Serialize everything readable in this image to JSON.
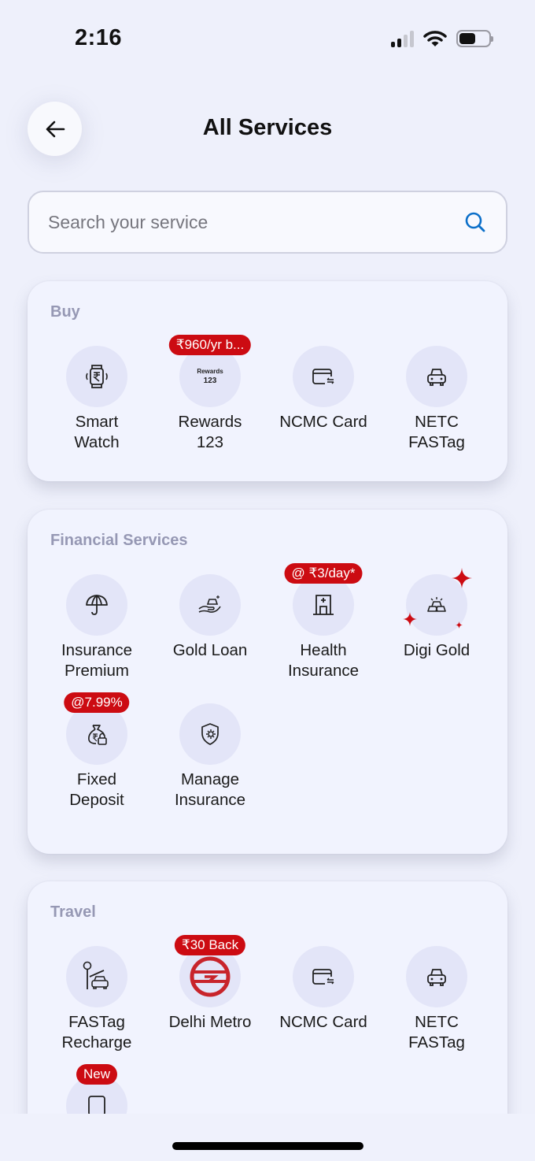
{
  "status_bar": {
    "time": "2:16"
  },
  "header": {
    "title": "All Services",
    "back_icon": "arrow-left-icon"
  },
  "search": {
    "placeholder": "Search your service",
    "value": "",
    "icon": "search-icon"
  },
  "colors": {
    "badge": "#cc0b12",
    "accent": "#0b6fc9",
    "section_title": "#9698b4",
    "icon_bg": "#e3e5f8",
    "background": "#eef0fb"
  },
  "sections": [
    {
      "title": "Buy",
      "items": [
        {
          "label": "Smart\nWatch",
          "icon": "smart-watch-rupee-icon",
          "badge": null
        },
        {
          "label": "Rewards\n123",
          "icon": "rewards-123-logo",
          "badge": "₹960/yr b...",
          "logo_line1": "Rewards",
          "logo_line2": "123"
        },
        {
          "label": "NCMC Card",
          "icon": "card-transfer-icon",
          "badge": null
        },
        {
          "label": "NETC\nFASTag",
          "icon": "car-icon",
          "badge": null
        }
      ]
    },
    {
      "title": "Financial Services",
      "items": [
        {
          "label": "Insurance\nPremium",
          "icon": "umbrella-icon",
          "badge": null
        },
        {
          "label": "Gold Loan",
          "icon": "gold-in-hand-icon",
          "badge": null
        },
        {
          "label": "Health\nInsurance",
          "icon": "hospital-icon",
          "badge": "@ ₹3/day*"
        },
        {
          "label": "Digi Gold",
          "icon": "gold-bars-icon",
          "badge": null,
          "sparkles": true
        },
        {
          "label": "Fixed\nDeposit",
          "icon": "money-bag-lock-icon",
          "badge": "@7.99%"
        },
        {
          "label": "Manage\nInsurance",
          "icon": "shield-gear-icon",
          "badge": null
        }
      ]
    },
    {
      "title": "Travel",
      "items": [
        {
          "label": "FASTag\nRecharge",
          "icon": "toll-gate-car-icon",
          "badge": null
        },
        {
          "label": "Delhi Metro",
          "icon": "delhi-metro-logo",
          "badge": "₹30 Back"
        },
        {
          "label": "NCMC Card",
          "icon": "card-transfer-icon",
          "badge": null
        },
        {
          "label": "NETC\nFASTag",
          "icon": "car-icon",
          "badge": null
        },
        {
          "label": "",
          "icon": "card-icon",
          "badge": "New"
        }
      ]
    }
  ]
}
